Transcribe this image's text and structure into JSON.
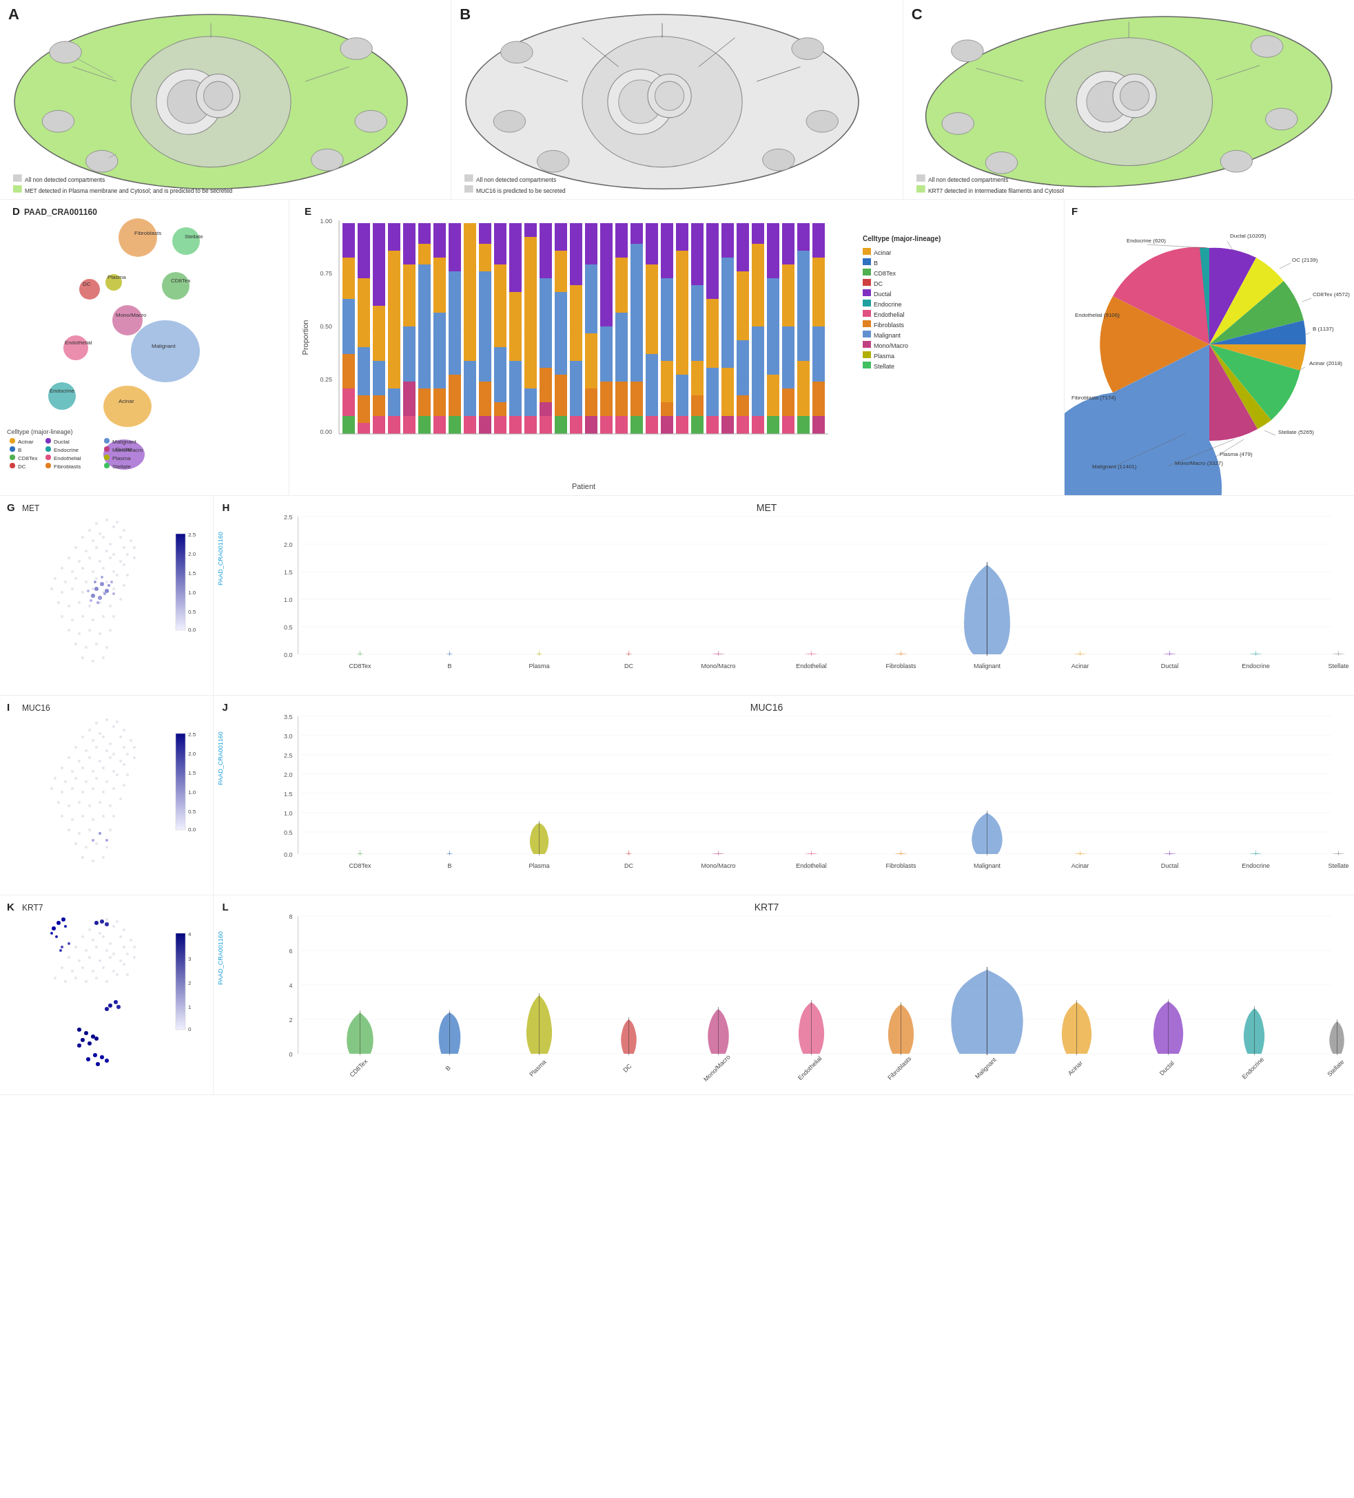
{
  "panels": {
    "A": {
      "label": "A",
      "legend1": "All non detected compartments",
      "legend2": "MET detected in Plasma membrane and Cytosol; and is predicted to be secreted",
      "color1": "#d0d0d0",
      "color2": "#90ee90"
    },
    "B": {
      "label": "B",
      "legend1": "All non detected compartments",
      "legend2": "MUC16 is predicted to be secreted",
      "color1": "#d0d0d0",
      "color2": "#d0d0d0"
    },
    "C": {
      "label": "C",
      "legend1": "All non detected compartments",
      "legend2": "KRT7 detected in Intermediate filaments and Cytosol",
      "color1": "#d0d0d0",
      "color2": "#90ee90"
    },
    "D": {
      "label": "D",
      "title": "PAAD_CRA001160",
      "celltypes": [
        {
          "name": "Acinar",
          "color": "#e8a020"
        },
        {
          "name": "B",
          "color": "#3070c0"
        },
        {
          "name": "CD8Tex",
          "color": "#50b050"
        },
        {
          "name": "DC",
          "color": "#d04040"
        },
        {
          "name": "Ductal",
          "color": "#8030c0"
        },
        {
          "name": "Endocrine",
          "color": "#20a0a0"
        },
        {
          "name": "Endothelial",
          "color": "#e05080"
        },
        {
          "name": "Fibroblasts",
          "color": "#e08020"
        },
        {
          "name": "Malignant",
          "color": "#6090d0"
        },
        {
          "name": "Mono/Macro",
          "color": "#c04080"
        },
        {
          "name": "Plasma",
          "color": "#b0b000"
        },
        {
          "name": "Stellate",
          "color": "#40c060"
        }
      ],
      "cluster_labels": [
        "Fibroblasts",
        "Stellate",
        "DC",
        "Plasma",
        "CD8Tex",
        "Mono/Macro",
        "Malignant",
        "Endocrine",
        "Acinar",
        "Endothelial",
        "Ductal"
      ]
    },
    "E": {
      "label": "E",
      "xlabel": "Patient",
      "ylabel": "Proportion",
      "legend_title": "Celltype (major-lineage)",
      "legend_items": [
        {
          "name": "Acinar",
          "color": "#e8a020"
        },
        {
          "name": "B",
          "color": "#3070c0"
        },
        {
          "name": "CD8Tex",
          "color": "#50b050"
        },
        {
          "name": "DC",
          "color": "#d04040"
        },
        {
          "name": "Ductal",
          "color": "#8030c0"
        },
        {
          "name": "Endocrine",
          "color": "#20a0a0"
        },
        {
          "name": "Endothelial",
          "color": "#e05080"
        },
        {
          "name": "Fibroblasts",
          "color": "#e08020"
        },
        {
          "name": "Malignant",
          "color": "#6090d0"
        },
        {
          "name": "Mono/Macro",
          "color": "#c04080"
        },
        {
          "name": "Plasma",
          "color": "#b0b000"
        },
        {
          "name": "Stellate",
          "color": "#40c060"
        }
      ]
    },
    "F": {
      "label": "F",
      "slices": [
        {
          "name": "Ductal (10205)",
          "value": 10205,
          "color": "#8030c0"
        },
        {
          "name": "OC (2139)",
          "value": 2139,
          "color": "#e8e820"
        },
        {
          "name": "CD8Tex (4572)",
          "value": 4572,
          "color": "#50b050"
        },
        {
          "name": "B (1137)",
          "value": 1137,
          "color": "#3070c0"
        },
        {
          "name": "Acinar (2018)",
          "value": 2018,
          "color": "#e8a020"
        },
        {
          "name": "Stellate (5265)",
          "value": 5265,
          "color": "#40c060"
        },
        {
          "name": "Plasma (479)",
          "value": 479,
          "color": "#b0b000"
        },
        {
          "name": "Mono/Macro (3327)",
          "value": 3327,
          "color": "#c04080"
        },
        {
          "name": "Malignant (11401)",
          "value": 11401,
          "color": "#6090d0"
        },
        {
          "name": "Acinar (2018)",
          "value": 2018,
          "color": "#e8a020"
        },
        {
          "name": "Fibroblasts (7174)",
          "value": 7174,
          "color": "#e08020"
        },
        {
          "name": "Endothelial (9106)",
          "value": 9106,
          "color": "#e05080"
        },
        {
          "name": "Endocrine (620)",
          "value": 620,
          "color": "#20a0a0"
        }
      ]
    },
    "G": {
      "label": "G",
      "title": "MET",
      "scale_max": "2.5",
      "scale_mid1": "2.0",
      "scale_mid2": "1.5",
      "scale_mid3": "1.0",
      "scale_mid4": "0.5",
      "scale_min": "0.0"
    },
    "H": {
      "label": "H",
      "title": "MET",
      "dataset": "PAAD_CRA001160",
      "celltypes": [
        "CD8Tex",
        "B",
        "Plasma",
        "DC",
        "Mono/Macro",
        "Endothelial",
        "Fibroblasts",
        "Malignant",
        "Acinar",
        "Ductal",
        "Endocrine",
        "Stellate"
      ],
      "ymax": "2.5",
      "ymid1": "2.0",
      "ymid2": "1.5",
      "ymid3": "1.0",
      "ymid4": "0.5",
      "ymin": "0.0"
    },
    "I": {
      "label": "I",
      "title": "MUC16",
      "scale_max": "2.5",
      "scale_mid1": "2.0",
      "scale_mid2": "1.5",
      "scale_mid3": "1.0",
      "scale_mid4": "0.5",
      "scale_min": "0.0"
    },
    "J": {
      "label": "J",
      "title": "MUC16",
      "dataset": "PAAD_CRA001160",
      "celltypes": [
        "CD8Tex",
        "B",
        "Plasma",
        "DC",
        "Mono/Macro",
        "Endothelial",
        "Fibroblasts",
        "Malignant",
        "Acinar",
        "Ductal",
        "Endocrine",
        "Stellate"
      ],
      "ymax": "3.5",
      "ymid1": "3.0",
      "ymid2": "2.5",
      "ymid3": "2.0",
      "ymid4": "1.5",
      "ymid5": "1.0",
      "ymid6": "0.5",
      "ymin": "0.0"
    },
    "K": {
      "label": "K",
      "title": "KRT7",
      "scale_max": "4",
      "scale_mid1": "3",
      "scale_mid2": "2",
      "scale_mid3": "1",
      "scale_min": "0"
    },
    "L": {
      "label": "L",
      "title": "KRT7",
      "dataset": "PAAD_CRA001160",
      "celltypes": [
        "CD8Tex",
        "B",
        "Plasma",
        "DC",
        "Mono/Macro",
        "Endothelial",
        "Fibroblasts",
        "Malignant",
        "Acinar",
        "Ductal",
        "Endocrine",
        "Stellate"
      ],
      "ymax": "8",
      "ymid1": "6",
      "ymid2": "4",
      "ymid3": "2",
      "ymin": "0"
    }
  },
  "violin_colors": {
    "CD8Tex": "#50b050",
    "B": "#3070c0",
    "Plasma": "#b0b000",
    "DC": "#d04040",
    "Mono/Macro": "#c04080",
    "Endothelial": "#e05080",
    "Fibroblasts": "#e08020",
    "Malignant": "#6090d0",
    "Acinar": "#e8a020",
    "Ductal": "#8030c0",
    "Endocrine": "#20a0a0",
    "Stellate": "#808080"
  }
}
